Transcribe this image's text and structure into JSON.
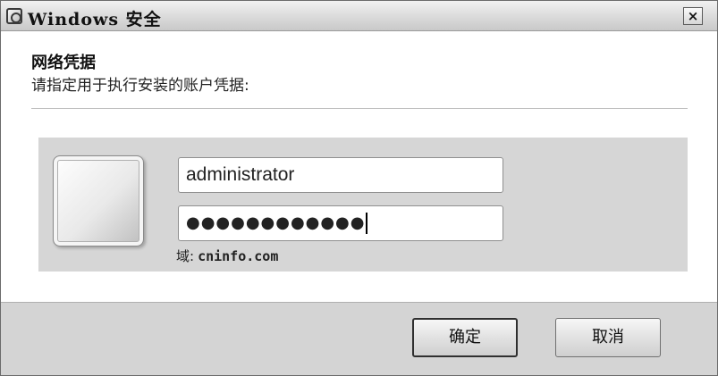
{
  "window": {
    "title": "Windows 安全",
    "close_label": "×"
  },
  "header": {
    "title": "网络凭据",
    "subtitle": "请指定用于执行安装的账户凭据:"
  },
  "credentials": {
    "username_value": "administrator",
    "password_mask": "●●●●●●●●●●●●",
    "domain_label": "域:",
    "domain_value": "cninfo.com"
  },
  "buttons": {
    "ok_label": "确定",
    "cancel_label": "取消"
  }
}
